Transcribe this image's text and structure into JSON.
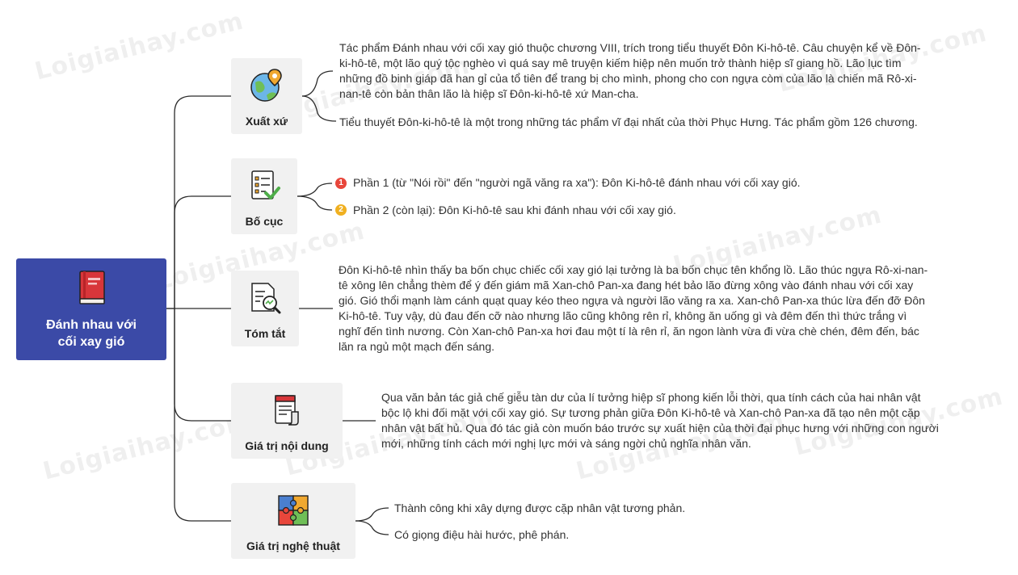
{
  "watermark": "Loigiaihay.com",
  "root": {
    "title": "Đánh nhau với\ncối xay gió",
    "icon": "book-icon"
  },
  "branches": [
    {
      "label": "Xuất xứ",
      "icon": "globe-location-icon",
      "items": [
        "Tác phẩm Đánh nhau với cối xay gió thuộc chương VIII, trích trong tiểu thuyết Đôn Ki-hô-tê. Câu chuyện kể về Đôn-ki-hô-tê, một lão quý tộc nghèo vì quá say mê truyện kiếm hiệp nên muốn trở thành hiệp sĩ giang hồ. Lão lục tìm những đồ binh giáp đã han gỉ của tổ tiên để trang bị cho mình, phong cho con ngựa còm của lão là chiến mã Rô-xi-nan-tê còn bản thân lão là hiệp sĩ Đôn-ki-hô-tê xứ Man-cha.",
        "Tiểu thuyết Đôn-ki-hô-tê là một trong những tác phẩm vĩ đại nhất của thời Phục Hưng. Tác phẩm gồm 126 chương."
      ]
    },
    {
      "label": "Bố cục",
      "icon": "checklist-icon",
      "items": [
        {
          "number": "1",
          "color": "#e8463b",
          "text": "Phần 1 (từ \"Nói rồi\" đến \"người ngã văng ra xa\"): Đôn Ki-hô-tê đánh nhau với cối xay gió."
        },
        {
          "number": "2",
          "color": "#f0b020",
          "text": "Phần 2 (còn lại): Đôn Ki-hô-tê sau khi đánh nhau với cối xay gió."
        }
      ]
    },
    {
      "label": "Tóm tắt",
      "icon": "document-search-icon",
      "items": [
        "Đôn Ki-hô-tê nhìn thấy ba bốn chục chiếc cối xay gió lại tưởng là ba bốn chục tên khổng lồ. Lão thúc ngựa Rô-xi-nan-tê xông lên chẳng thèm để ý đến giám mã Xan-chô Pan-xa đang hét bảo lão đừng xông vào đánh nhau với cối xay gió. Gió thổi mạnh làm cánh quạt quay kéo theo ngựa và người lão văng ra xa. Xan-chô Pan-xa thúc lừa đến đỡ Đôn Ki-hô-tê. Tuy vậy, dù đau đến cỡ nào nhưng lão cũng không rên rỉ, không ăn uống gì và đêm đến thì thức trắng vì nghĩ đến tình nương. Còn Xan-chô Pan-xa hơi đau một tí là rên rỉ, ăn ngon lành vừa đi vừa chè chén, đêm đến, bác lăn ra ngủ một mạch đến sáng."
      ]
    },
    {
      "label": "Giá trị nội dung",
      "icon": "scroll-icon",
      "items": [
        "Qua văn bản tác giả chế giễu tàn dư của lí tưởng hiệp sĩ phong kiến lỗi thời, qua tính cách của hai nhân vật bộc lộ khi đối mặt với cối xay gió. Sự tương phản giữa Đôn Ki-hô-tê và Xan-chô Pan-xa đã tạo nên một cặp nhân vật bất hủ. Qua đó tác giả còn muốn báo trước sự xuất hiện của thời đại phục hưng với những con người mới, những tính cách mới nghị lực mới và sáng ngời chủ nghĩa nhân văn."
      ]
    },
    {
      "label": "Giá trị nghệ thuật",
      "icon": "puzzle-icon",
      "items": [
        "Thành công khi xây dựng được cặp nhân vật tương phản.",
        "Có giọng điệu hài hước, phê phán."
      ]
    }
  ]
}
